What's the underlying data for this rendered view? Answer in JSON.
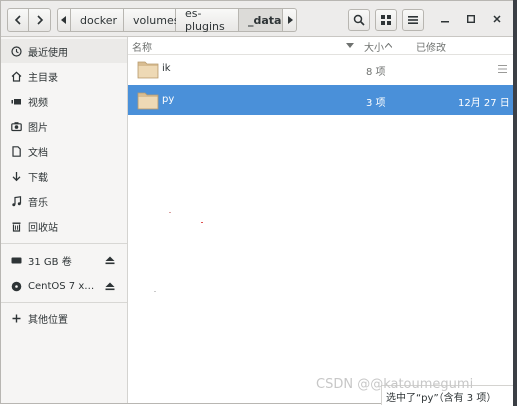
{
  "toolbar": {
    "back_icon": "chevron-left-icon",
    "forward_icon": "chevron-right-icon",
    "search_icon": "search-icon",
    "view_icon": "grid-view-icon",
    "menu_icon": "hamburger-menu-icon"
  },
  "breadcrumb": {
    "items": [
      {
        "label": "docker"
      },
      {
        "label": "volumes"
      },
      {
        "label": "es-plugins"
      },
      {
        "label": "_data"
      }
    ]
  },
  "sidebar": {
    "items": [
      {
        "label": "最近使用",
        "icon": "clock-icon"
      },
      {
        "label": "主目录",
        "icon": "home-icon"
      },
      {
        "label": "视频",
        "icon": "video-icon"
      },
      {
        "label": "图片",
        "icon": "camera-icon"
      },
      {
        "label": "文档",
        "icon": "document-icon"
      },
      {
        "label": "下载",
        "icon": "download-icon"
      },
      {
        "label": "音乐",
        "icon": "music-icon"
      },
      {
        "label": "回收站",
        "icon": "trash-icon"
      }
    ],
    "devices": [
      {
        "label": "31 GB 卷",
        "icon": "drive-icon"
      },
      {
        "label": "CentOS 7 x…",
        "icon": "disc-icon"
      }
    ],
    "other": {
      "label": "其他位置",
      "icon": "plus-icon"
    }
  },
  "columns": {
    "name": "名称",
    "size": "大小",
    "modified": "已修改"
  },
  "files": [
    {
      "name": "ik",
      "size": "8 项",
      "modified": "",
      "selected": false
    },
    {
      "name": "py",
      "size": "3 项",
      "modified": "12月 27 日",
      "selected": true
    }
  ],
  "status": "选中了“py”（含有 3 项）",
  "watermark": "CSDN @@katoumegumi"
}
